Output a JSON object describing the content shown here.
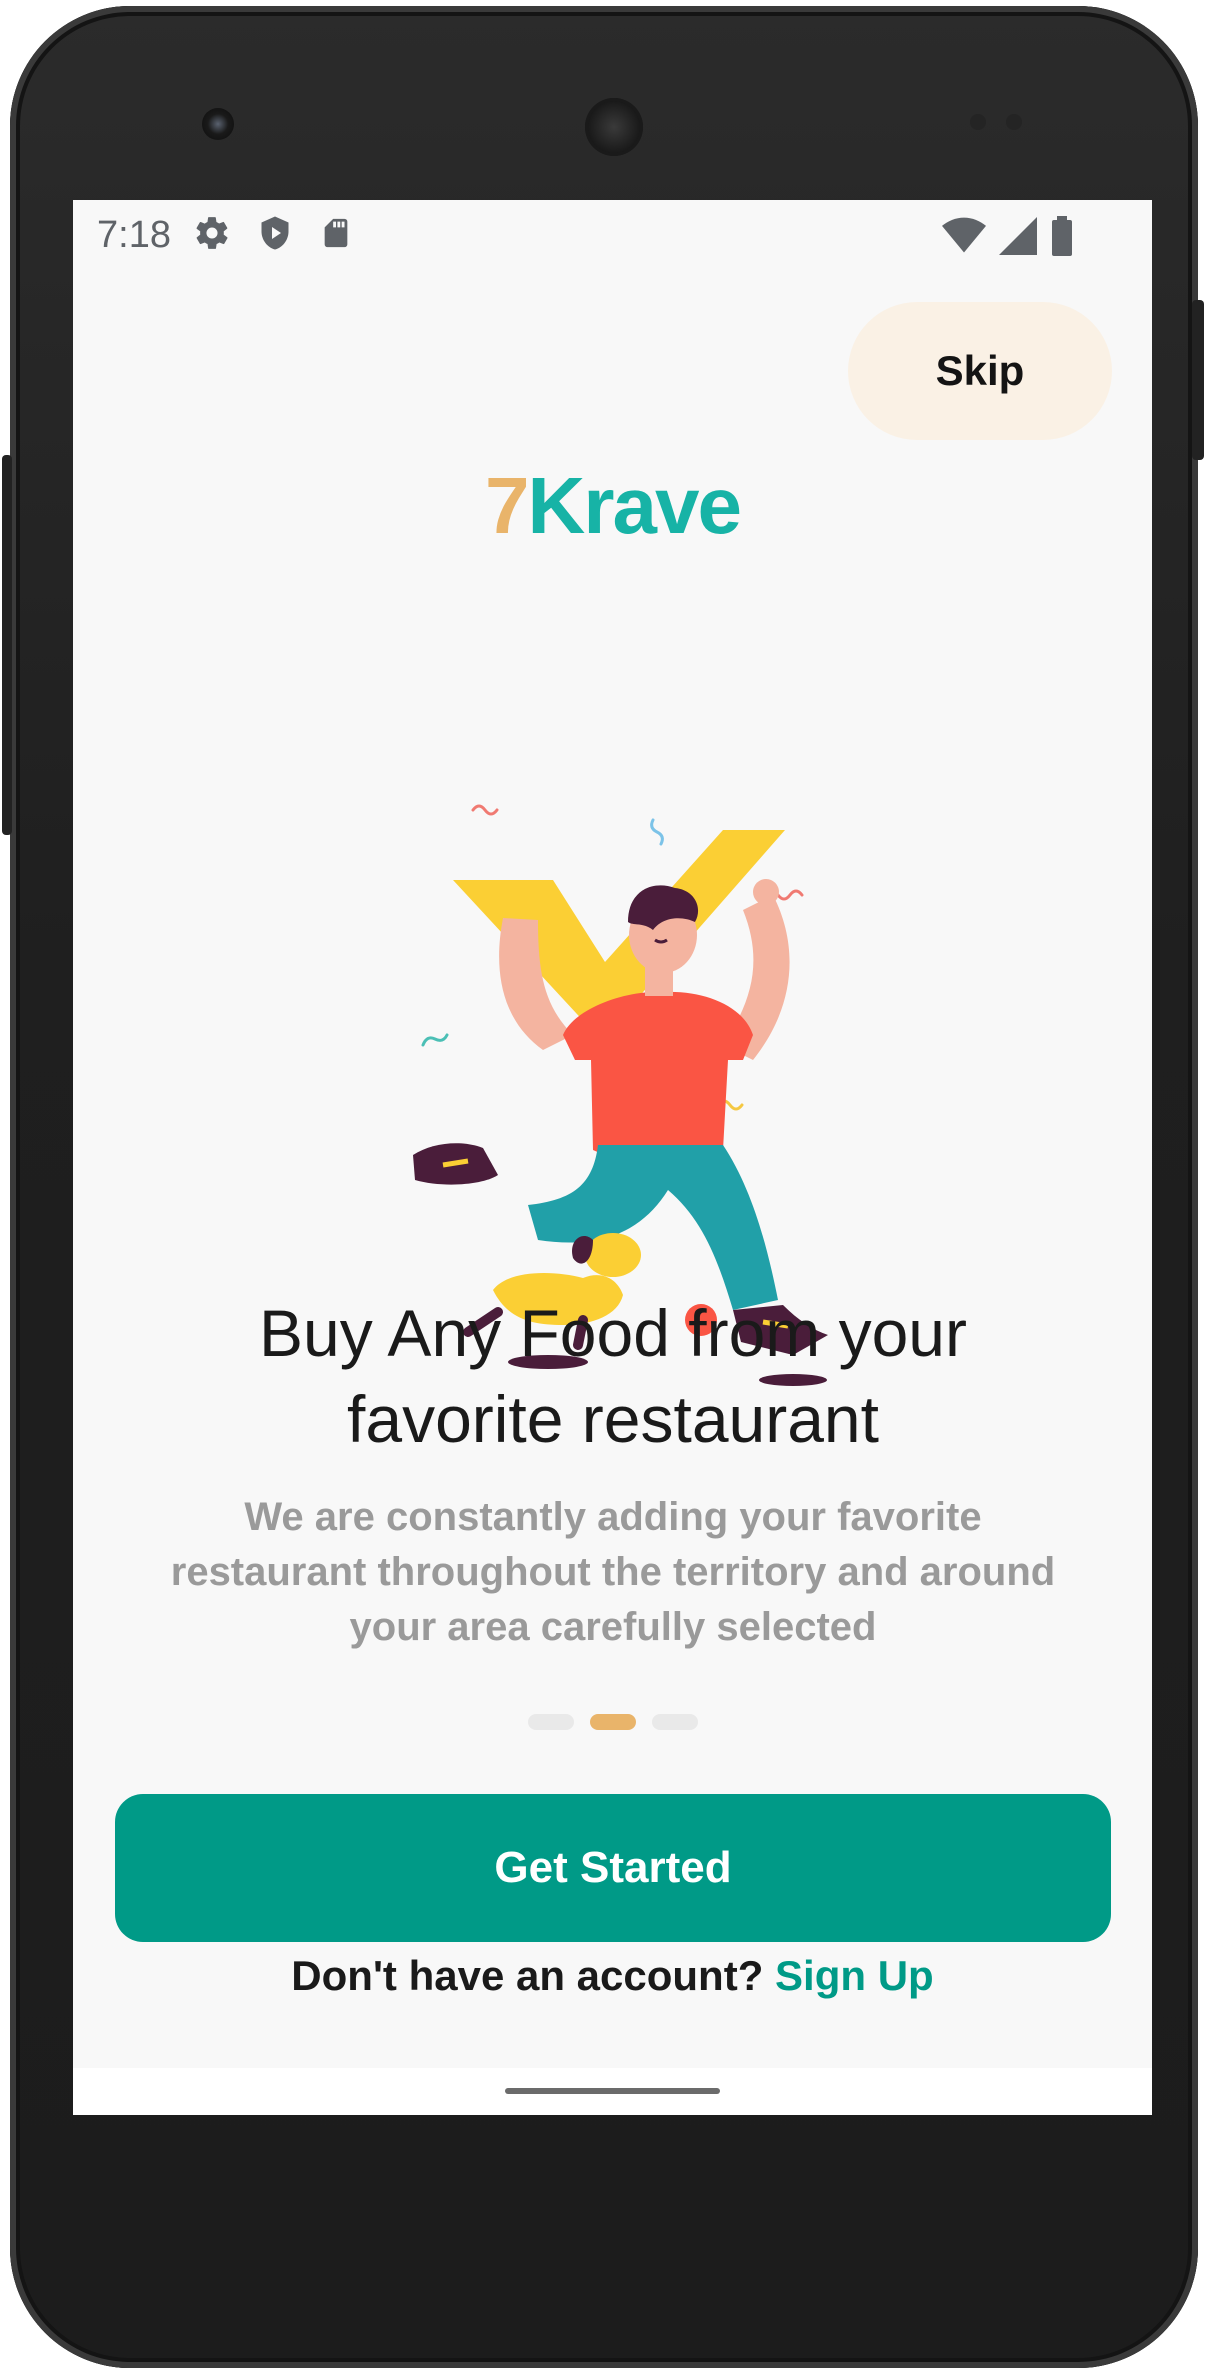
{
  "status_bar": {
    "time": "7:18",
    "left_icons": [
      "settings-icon",
      "shield-play-icon",
      "sd-card-icon"
    ],
    "right_icons": [
      "wifi-icon",
      "signal-icon",
      "battery-icon"
    ]
  },
  "skip_label": "Skip",
  "logo": {
    "numeral": "7",
    "word": "Krave"
  },
  "onboarding": {
    "title_line1": "Buy Any Food from your",
    "title_line2": "favorite restaurant",
    "body_line1": "We are constantly adding your favorite",
    "body_line2": "restaurant throughout the territory and around",
    "body_line3": "your area carefully selected",
    "page_count": 3,
    "active_page": 2
  },
  "cta_label": "Get Started",
  "signup": {
    "prompt": "Don't have an account?",
    "link": "Sign Up"
  },
  "colors": {
    "primary": "#009a87",
    "logo_teal": "#17b3a6",
    "logo_gold": "#e9b46a",
    "skip_bg": "#faf1e5",
    "screen_bg": "#f8f8f8"
  }
}
